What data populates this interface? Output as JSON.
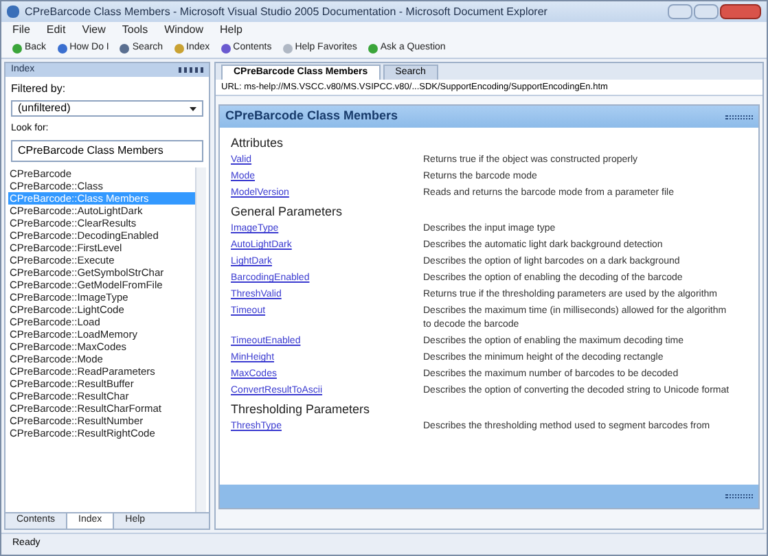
{
  "window": {
    "title": "CPreBarcode Class Members - Microsoft Visual Studio 2005 Documentation - Microsoft Document Explorer"
  },
  "menu": [
    "File",
    "Edit",
    "View",
    "Tools",
    "Window",
    "Help"
  ],
  "toolbar": [
    {
      "label": "Back",
      "kind": "back"
    },
    {
      "label": "How Do I",
      "kind": "help"
    },
    {
      "label": "Search",
      "kind": "search"
    },
    {
      "label": "Index",
      "kind": "index"
    },
    {
      "label": "Contents",
      "kind": "contents"
    },
    {
      "label": "Help Favorites",
      "kind": "favorites"
    },
    {
      "label": "Ask a Question",
      "kind": "ask"
    }
  ],
  "index_panel": {
    "title": "Index",
    "filter_label": "Filtered by:",
    "filter_value": "(unfiltered)",
    "look_for_label": "Look for:",
    "look_for_value": "CPreBarcode Class Members",
    "items": [
      {
        "label": "CPreBarcode",
        "selected": false
      },
      {
        "label": "CPreBarcode::Class",
        "selected": false
      },
      {
        "label": "CPreBarcode::Class Members",
        "selected": true
      },
      {
        "label": "CPreBarcode::AutoLightDark",
        "selected": false
      },
      {
        "label": "CPreBarcode::ClearResults",
        "selected": false
      },
      {
        "label": "CPreBarcode::DecodingEnabled",
        "selected": false
      },
      {
        "label": "CPreBarcode::FirstLevel",
        "selected": false
      },
      {
        "label": "CPreBarcode::Execute",
        "selected": false
      },
      {
        "label": "CPreBarcode::GetSymbolStrChar",
        "selected": false
      },
      {
        "label": "CPreBarcode::GetModelFromFile",
        "selected": false
      },
      {
        "label": "CPreBarcode::ImageType",
        "selected": false
      },
      {
        "label": "CPreBarcode::LightCode",
        "selected": false
      },
      {
        "label": "CPreBarcode::Load",
        "selected": false
      },
      {
        "label": "CPreBarcode::LoadMemory",
        "selected": false
      },
      {
        "label": "CPreBarcode::MaxCodes",
        "selected": false
      },
      {
        "label": "CPreBarcode::Mode",
        "selected": false
      },
      {
        "label": "CPreBarcode::ReadParameters",
        "selected": false
      },
      {
        "label": "CPreBarcode::ResultBuffer",
        "selected": false
      },
      {
        "label": "CPreBarcode::ResultChar",
        "selected": false
      },
      {
        "label": "CPreBarcode::ResultCharFormat",
        "selected": false
      },
      {
        "label": "CPreBarcode::ResultNumber",
        "selected": false
      },
      {
        "label": "CPreBarcode::ResultRightCode",
        "selected": false
      }
    ],
    "tabs": [
      {
        "label": "Contents",
        "selected": false
      },
      {
        "label": "Index",
        "selected": true
      },
      {
        "label": "Help",
        "selected": false
      }
    ]
  },
  "document": {
    "tabs": [
      {
        "label": "CPreBarcode Class Members",
        "selected": true
      },
      {
        "label": "Search",
        "selected": false
      }
    ],
    "url": "URL: ms-help://MS.VSCC.v80/MS.VSIPCC.v80/...SDK/SupportEncoding/SupportEncodingEn.htm",
    "header": "CPreBarcode Class Members",
    "sections": [
      {
        "heading": "Attributes",
        "rows": [
          {
            "name": "Valid",
            "description": "Returns true if the object was constructed properly"
          },
          {
            "name": "Mode",
            "description": "Returns the barcode mode"
          },
          {
            "name": "ModelVersion",
            "description": "Reads and returns the barcode mode from a parameter file"
          }
        ]
      },
      {
        "heading": "General Parameters",
        "rows": [
          {
            "name": "ImageType",
            "description": "Describes the input image type"
          },
          {
            "name": "AutoLightDark",
            "description": "Describes the automatic light dark background detection"
          },
          {
            "name": "LightDark",
            "description": "Describes the option of light barcodes on a dark background"
          },
          {
            "name": "BarcodingEnabled",
            "description": "Describes the option of enabling the decoding of the barcode"
          },
          {
            "name": "ThreshValid",
            "description": "Returns true if the thresholding parameters are used by the algorithm"
          },
          {
            "name": "Timeout",
            "description": "Describes the maximum time (in milliseconds) allowed for the algorithm to decode the barcode"
          },
          {
            "name": "TimeoutEnabled",
            "description": "Describes the option of enabling the maximum decoding time"
          },
          {
            "name": "MinHeight",
            "description": "Describes the minimum height of the decoding rectangle"
          },
          {
            "name": "MaxCodes",
            "description": "Describes the maximum number of barcodes to be decoded"
          },
          {
            "name": "ConvertResultToAscii",
            "description": "Describes the option of converting the decoded string to Unicode format"
          }
        ]
      },
      {
        "heading": "Thresholding Parameters",
        "rows": [
          {
            "name": "ThreshType",
            "description": "Describes the thresholding method used to segment barcodes from"
          }
        ]
      }
    ]
  },
  "status_bar": "Ready"
}
